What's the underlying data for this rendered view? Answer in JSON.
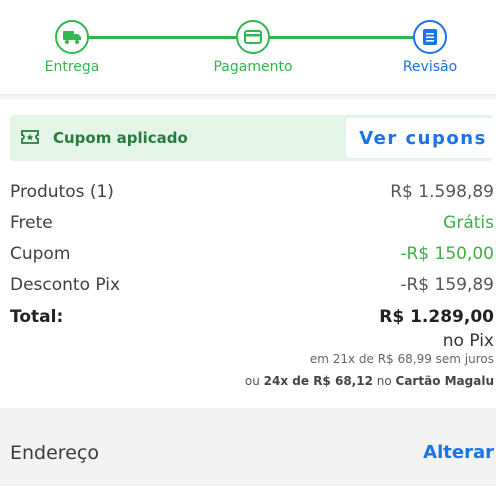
{
  "stepper": {
    "steps": [
      {
        "label": "Entrega",
        "icon": "truck-icon",
        "state": "done"
      },
      {
        "label": "Pagamento",
        "icon": "card-icon",
        "state": "done"
      },
      {
        "label": "Revisão",
        "icon": "list-icon",
        "state": "active"
      }
    ],
    "colors": {
      "done": "#2fb84e",
      "active": "#1a73e8"
    }
  },
  "coupon": {
    "label": "Cupom aplicado",
    "button": "Ver cupons",
    "icon": "ticket-icon"
  },
  "summary": {
    "products_label": "Produtos (1)",
    "products_value": "R$ 1.598,89",
    "shipping_label": "Frete",
    "shipping_value": "Grátis",
    "coupon_label": "Cupom",
    "coupon_value": "-R$ 150,00",
    "pix_discount_label": "Desconto Pix",
    "pix_discount_value": "-R$ 159,89",
    "total_label": "Total:",
    "total_value": "R$ 1.289,00",
    "total_suffix": "no Pix",
    "installments_text": "em 21x de R$ 68,99 sem juros",
    "card_prefix": "ou",
    "card_installments": "24x de R$ 68,12",
    "card_middle": "no",
    "card_name": "Cartão Magalu"
  },
  "address": {
    "title": "Endereço",
    "change": "Alterar"
  }
}
